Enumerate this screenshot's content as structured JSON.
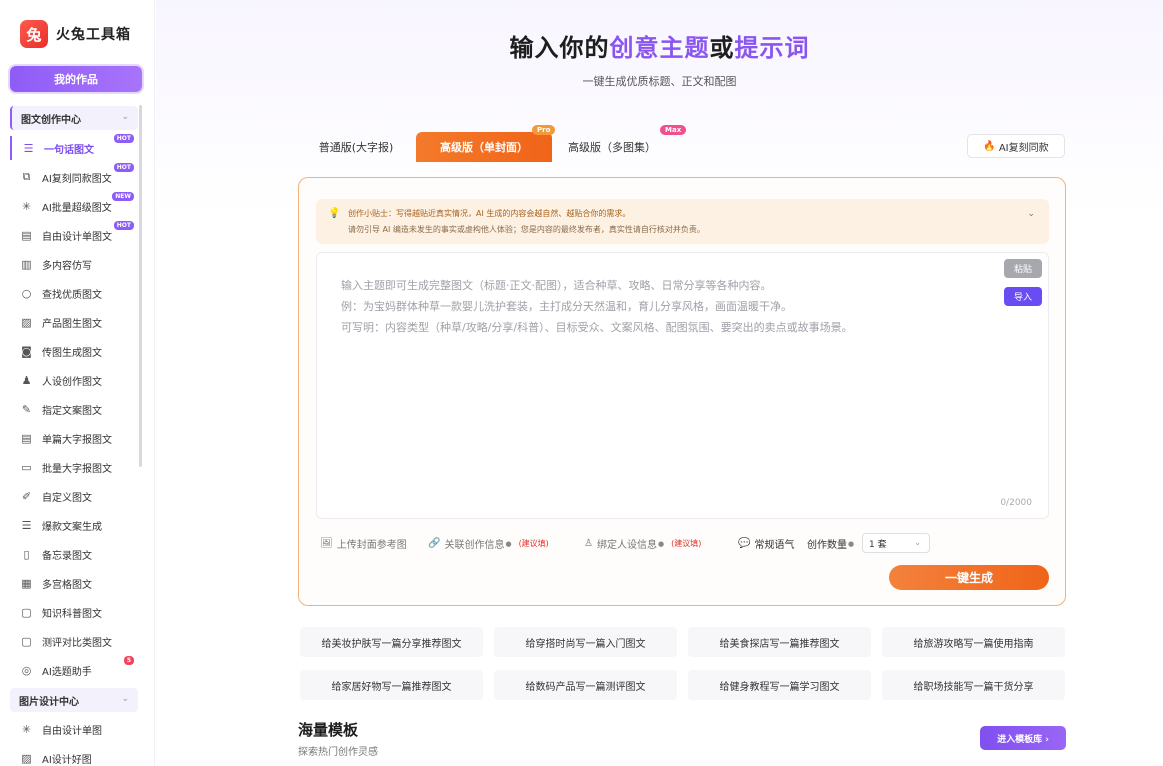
{
  "brand": {
    "logo_glyph": "兔",
    "name": "火兔工具箱"
  },
  "sidebar": {
    "my_works": "我的作品",
    "section1": "图文创作中心",
    "section2": "图片设计中心",
    "items": [
      {
        "label": "一句话图文",
        "icon": "doc-lines-icon",
        "tag": "HOT"
      },
      {
        "label": "AI复刻同款图文",
        "icon": "copy-icon",
        "tag": "HOT"
      },
      {
        "label": "AI批量超级图文",
        "icon": "sparkle-icon",
        "tag": "NEW"
      },
      {
        "label": "自由设计单图文",
        "icon": "doc-icon",
        "tag": "HOT"
      },
      {
        "label": "多内容仿写",
        "icon": "doc-stack-icon",
        "tag": ""
      },
      {
        "label": "查找优质图文",
        "icon": "search-icon",
        "tag": ""
      },
      {
        "label": "产品图生图文",
        "icon": "image-icon",
        "tag": ""
      },
      {
        "label": "传图生成图文",
        "icon": "camera-icon",
        "tag": ""
      },
      {
        "label": "人设创作图文",
        "icon": "person-icon",
        "tag": ""
      },
      {
        "label": "指定文案图文",
        "icon": "edit-icon",
        "tag": ""
      },
      {
        "label": "单篇大字报图文",
        "icon": "doc-icon",
        "tag": ""
      },
      {
        "label": "批量大字报图文",
        "icon": "layers-icon",
        "tag": ""
      },
      {
        "label": "自定义图文",
        "icon": "pen-icon",
        "tag": ""
      },
      {
        "label": "爆款文案生成",
        "icon": "doc-lines-icon",
        "tag": ""
      },
      {
        "label": "备忘录图文",
        "icon": "memo-icon",
        "tag": ""
      },
      {
        "label": "多宫格图文",
        "icon": "grid-icon",
        "tag": ""
      },
      {
        "label": "知识科普图文",
        "icon": "book-icon",
        "tag": ""
      },
      {
        "label": "测评对比类图文",
        "icon": "book-icon",
        "tag": ""
      },
      {
        "label": "AI选题助手",
        "icon": "compass-icon",
        "tag": "5"
      }
    ],
    "items2": [
      {
        "label": "自由设计单图",
        "icon": "sparkle-icon"
      },
      {
        "label": "AI设计好图",
        "icon": "image-icon"
      }
    ]
  },
  "hero": {
    "title_a": "输入你的",
    "title_b": "创意主题",
    "title_c": "或",
    "title_d": "提示词",
    "subtitle": "一键生成优质标题、正文和配图"
  },
  "tabs": {
    "t1": "普通版(大字报)",
    "t2": "高级版（单封面）",
    "t3": "高级版（多图集）",
    "pro": "Pro",
    "max": "Max",
    "ai_copy": "AI复刻同款"
  },
  "tip": {
    "line1": "创作小贴士：写得越贴近真实情况，AI 生成的内容会越自然、越贴合你的需求。",
    "line2": "请勿引导 AI 编造未发生的事实或虚构他人体验；您是内容的最终发布者，真实性请自行核对并负责。"
  },
  "editor": {
    "ph1": "输入主题即可生成完整图文（标题·正文·配图），适合种草、攻略、日常分享等各种内容。",
    "ph2": "例：为宝妈群体种草一款婴儿洗护套装，主打成分天然温和，育儿分享风格，画面温暖干净。",
    "ph3": "可写明：内容类型（种草/攻略/分享/科普）、目标受众、文案风格、配图氛围、要突出的卖点或故事场景。",
    "paste": "粘贴",
    "import": "导入",
    "count": "0/2000"
  },
  "options": {
    "upload": "上传封面参考图",
    "link": "关联创作信息",
    "persona": "绑定人设信息",
    "suggest": "(建议填)",
    "tone": "常规语气",
    "qty_label": "创作数量",
    "qty_value": "1 套"
  },
  "generate": "一键生成",
  "prompts": [
    "给美妆护肤写一篇分享推荐图文",
    "给穿搭时尚写一篇入门图文",
    "给美食探店写一篇推荐图文",
    "给旅游攻略写一篇使用指南",
    "给家居好物写一篇推荐图文",
    "给数码产品写一篇测评图文",
    "给健身教程写一篇学习图文",
    "给职场技能写一篇干货分享"
  ],
  "templates": {
    "title": "海量模板",
    "subtitle": "探索热门创作灵感",
    "button": "进入模板库 ›"
  },
  "colors": {
    "accent_purple": "#8e5cf6",
    "accent_orange": "#f06418",
    "import_blue": "#6a4cf3"
  }
}
